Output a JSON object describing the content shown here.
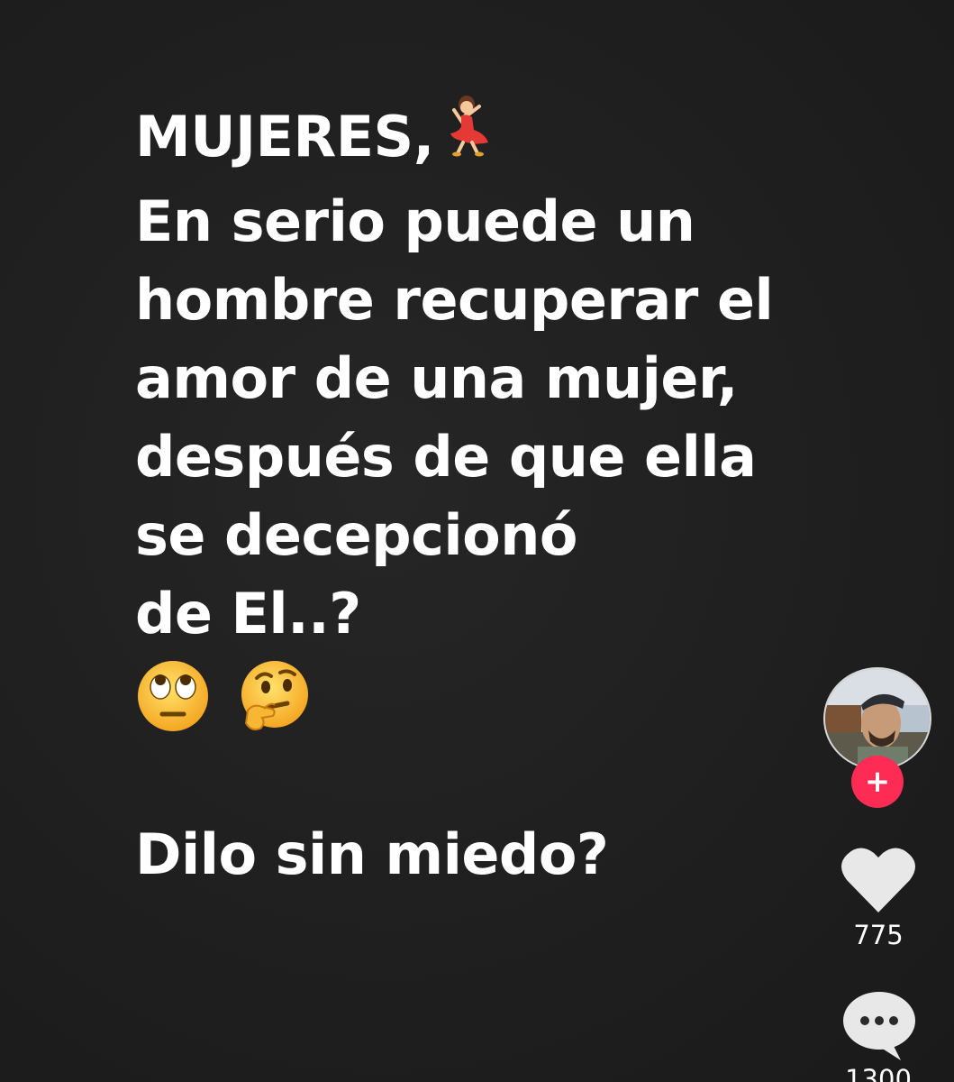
{
  "post": {
    "line1": "MUJERES,",
    "line2": "En serio puede un",
    "line3": "hombre recuperar el",
    "line4": "amor de una mujer,",
    "line5": "después de que ella",
    "line6": "se decepcionó",
    "line7": "de El..?",
    "question": "Dilo sin miedo?",
    "emojis": [
      "woman-dancing-emoji",
      "face-rolling-eyes-emoji",
      "thinking-face-emoji"
    ]
  },
  "actions": {
    "follow_label": "+",
    "like_count": "775",
    "comment_count": "1300"
  },
  "colors": {
    "background": "#1f1f1f",
    "text": "#ffffff",
    "follow": "#fe2c55",
    "icon": "#e8e8e8"
  }
}
